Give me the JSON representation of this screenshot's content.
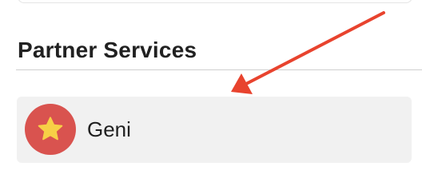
{
  "section": {
    "title": "Partner Services"
  },
  "services": [
    {
      "label": "Geni",
      "icon": "star-icon",
      "icon_bg_color": "#d9534f",
      "icon_color": "#f7d046"
    }
  ],
  "annotation": {
    "arrow_color": "#e8432e"
  }
}
